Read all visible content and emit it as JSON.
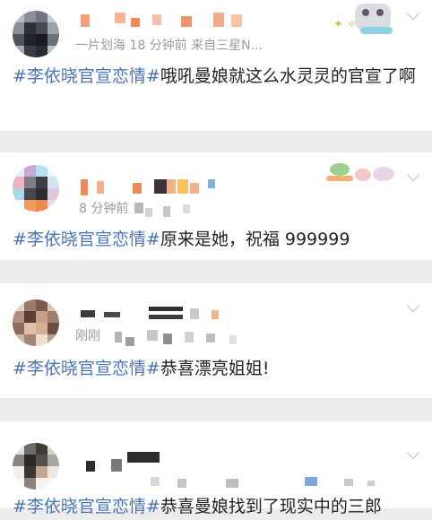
{
  "colors": {
    "background": "#ececec",
    "card": "#ffffff",
    "hashtag": "#4a74b7",
    "text": "#222222",
    "meta": "#9b9b9b"
  },
  "posts": [
    {
      "meta": "一片划海 18 分钟前   来自三星N...",
      "hashtag": "#李依晓官宣恋情#",
      "text": "哦吼曼娘就这么水灵灵的官宣了啊",
      "menu_icon": "chevron-down-icon"
    },
    {
      "meta": "8 分钟前",
      "hashtag": "#李依晓官宣恋情#",
      "text": "原来是她，祝福 999999",
      "menu_icon": "chevron-down-icon"
    },
    {
      "meta": "刚刚",
      "hashtag": "#李依晓官宣恋情#",
      "text": "恭喜漂亮姐姐!",
      "menu_icon": "chevron-down-icon"
    },
    {
      "meta": "",
      "hashtag": "#李依晓官宣恋情#",
      "text": "恭喜曼娘找到了现实中的三郎",
      "menu_icon": "chevron-down-icon"
    }
  ]
}
